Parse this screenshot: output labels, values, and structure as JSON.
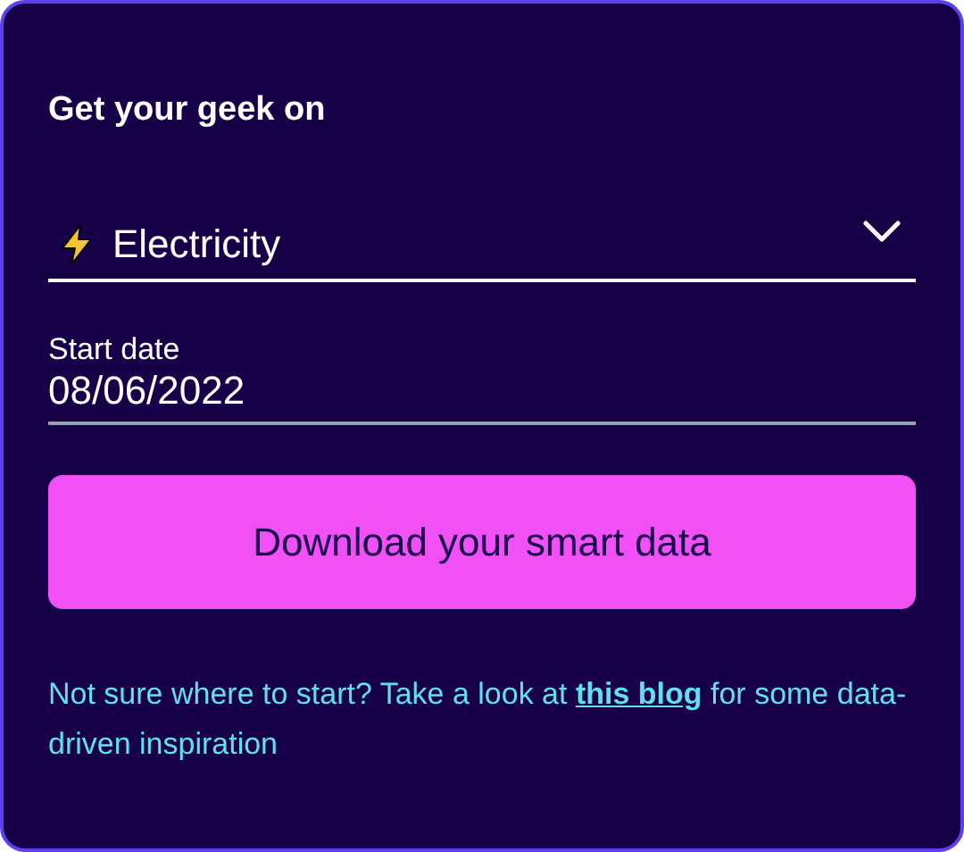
{
  "card": {
    "title": "Get your geek on",
    "fuel_select": {
      "value": "Electricity"
    },
    "start_date": {
      "label": "Start date",
      "value": "08/06/2022"
    },
    "button": "Download your smart data",
    "hint": {
      "before": "Not sure where to start? Take a look at ",
      "link": "this blog",
      "after": " for some data-driven inspiration"
    }
  }
}
